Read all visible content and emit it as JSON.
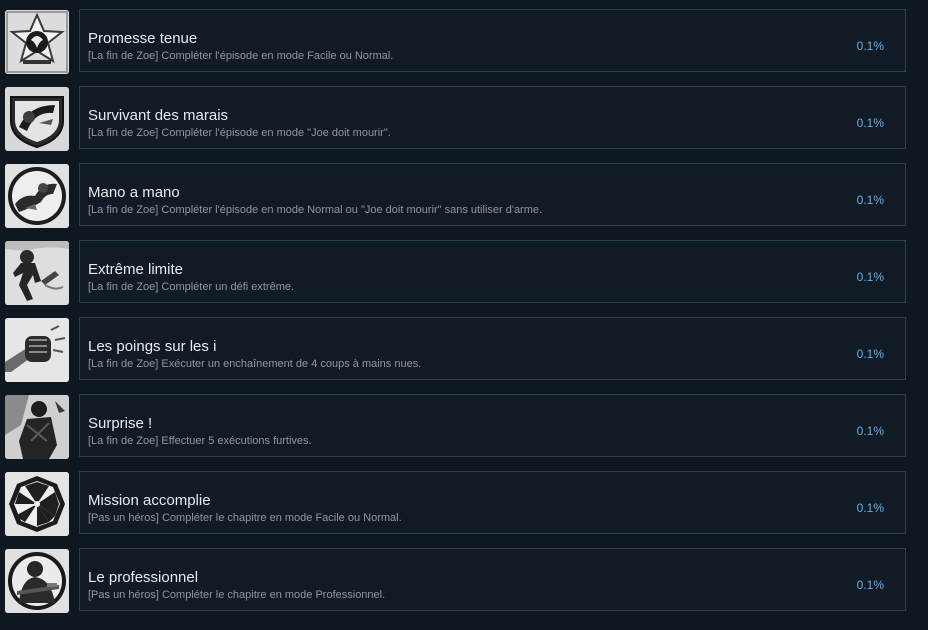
{
  "achievements": [
    {
      "title": "Promesse tenue",
      "description": "[La fin de Zoe] Compléter l'épisode en mode Facile ou Normal.",
      "percent": "0.1%",
      "icon": "star-emblem-icon"
    },
    {
      "title": "Survivant des marais",
      "description": "[La fin de Zoe] Compléter l'épisode en mode \"Joe doit mourir\".",
      "percent": "0.1%",
      "icon": "shield-crest-icon"
    },
    {
      "title": "Mano a mano",
      "description": "[La fin de Zoe] Compléter l'épisode en mode Normal ou \"Joe doit mourir\" sans utiliser d'arme.",
      "percent": "0.1%",
      "icon": "fist-fight-icon"
    },
    {
      "title": "Extrême limite",
      "description": "[La fin de Zoe] Compléter un défi extrême.",
      "percent": "0.1%",
      "icon": "fighter-figure-icon"
    },
    {
      "title": "Les poings sur les i",
      "description": "[La fin de Zoe] Exécuter un enchaînement de 4 coups à mains nues.",
      "percent": "0.1%",
      "icon": "punch-fist-icon"
    },
    {
      "title": "Surprise !",
      "description": "[La fin de Zoe] Effectuer 5 exécutions furtives.",
      "percent": "0.1%",
      "icon": "stealth-soldier-icon"
    },
    {
      "title": "Mission accomplie",
      "description": "[Pas un héros] Compléter le chapitre en mode Facile ou Normal.",
      "percent": "0.1%",
      "icon": "umbrella-logo-icon"
    },
    {
      "title": "Le professionnel",
      "description": "[Pas un héros] Compléter le chapitre en mode Professionnel.",
      "percent": "0.1%",
      "icon": "soldier-portrait-icon"
    }
  ]
}
